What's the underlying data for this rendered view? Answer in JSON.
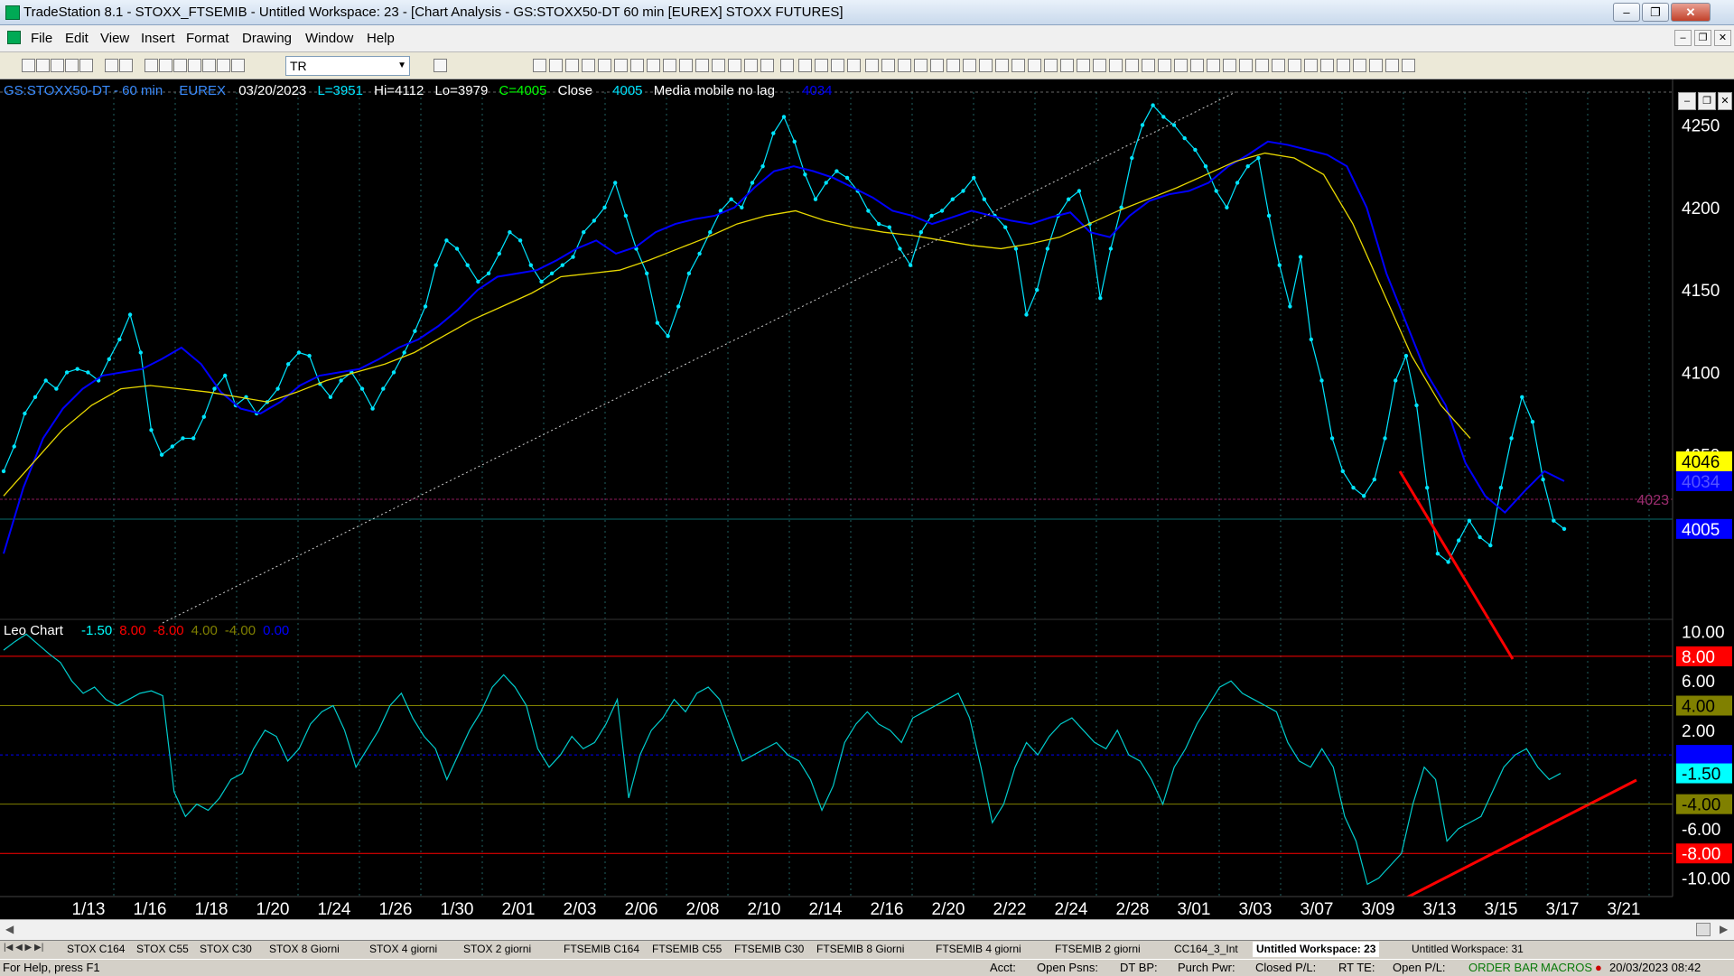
{
  "window": {
    "title": "TradeStation 8.1 - STOXX_FTSEMIB - Untitled Workspace:  23 - [Chart Analysis - GS:STOXX50-DT  60 min  [EUREX] STOXX FUTURES]",
    "minimize_label": "–",
    "restore_label": "❐",
    "close_label": "✕"
  },
  "menu": {
    "items": [
      "File",
      "Edit",
      "View",
      "Insert",
      "Format",
      "Drawing",
      "Window",
      "Help"
    ]
  },
  "toolbar": {
    "symbol": "TR"
  },
  "chart_header": {
    "symbol": "GS:STOXX50-DT - 60 min",
    "exchange": "EUREX",
    "date": "03/20/2023",
    "last": "L=3951",
    "high": "Hi=4112",
    "low": "Lo=3979",
    "close": "C=4005",
    "close_label": "Close",
    "close_value": "4005",
    "ma_label": "Media mobile no lag",
    "ma_value": "4034"
  },
  "osc_header": {
    "name": "Leo Chart",
    "values": [
      {
        "text": "-1.50",
        "color": "#00ffff"
      },
      {
        "text": "8.00",
        "color": "#ff0000"
      },
      {
        "text": "-8.00",
        "color": "#ff0000"
      },
      {
        "text": "4.00",
        "color": "#808000"
      },
      {
        "text": "-4.00",
        "color": "#808000"
      },
      {
        "text": "0.00",
        "color": "#0000ff"
      }
    ]
  },
  "chart_data": [
    {
      "type": "line",
      "price_axis_labels": [
        "4250",
        "4200",
        "4150",
        "4100",
        "4050"
      ],
      "ylim": [
        3960,
        4270
      ],
      "x_tick_labels": [
        "1/13",
        "1/16",
        "1/18",
        "1/20",
        "1/24",
        "1/26",
        "1/30",
        "2/01",
        "2/03",
        "2/06",
        "2/08",
        "2/10",
        "2/14",
        "2/16",
        "2/20",
        "2/22",
        "2/24",
        "2/28",
        "3/01",
        "3/03",
        "3/07",
        "3/09",
        "3/13",
        "3/15",
        "3/17",
        "3/21"
      ],
      "price_tags": [
        {
          "text": "4046",
          "value": 4046,
          "bg": "#ffff00",
          "fg": "#000000"
        },
        {
          "text": "4034",
          "value": 4034,
          "bg": "#0000ff",
          "fg": "#5555ff"
        },
        {
          "text": "4005",
          "value": 4005,
          "bg": "#0000ff",
          "fg": "#ffffff"
        }
      ],
      "reference_line": {
        "text": "4023",
        "value": 4023
      },
      "series": [
        {
          "name": "Close",
          "color": "#00e5ff",
          "values": [
            4040,
            4055,
            4075,
            4085,
            4095,
            4090,
            4100,
            4102,
            4100,
            4095,
            4108,
            4120,
            4135,
            4112,
            4065,
            4050,
            4055,
            4060,
            4060,
            4073,
            4090,
            4098,
            4080,
            4085,
            4075,
            4082,
            4090,
            4105,
            4112,
            4110,
            4093,
            4085,
            4095,
            4100,
            4090,
            4078,
            4090,
            4100,
            4112,
            4125,
            4140,
            4165,
            4180,
            4175,
            4165,
            4155,
            4160,
            4172,
            4185,
            4180,
            4165,
            4155,
            4160,
            4165,
            4170,
            4185,
            4192,
            4200,
            4215,
            4195,
            4175,
            4160,
            4130,
            4122,
            4140,
            4160,
            4172,
            4185,
            4198,
            4205,
            4200,
            4215,
            4225,
            4245,
            4255,
            4240,
            4220,
            4205,
            4215,
            4222,
            4218,
            4210,
            4198,
            4190,
            4188,
            4175,
            4165,
            4185,
            4195,
            4198,
            4205,
            4210,
            4218,
            4205,
            4195,
            4188,
            4175,
            4135,
            4150,
            4175,
            4195,
            4205,
            4210,
            4190,
            4145,
            4175,
            4200,
            4230,
            4250,
            4262,
            4255,
            4250,
            4242,
            4235,
            4225,
            4210,
            4200,
            4215,
            4225,
            4230,
            4195,
            4165,
            4140,
            4170,
            4120,
            4095,
            4060,
            4040,
            4030,
            4025,
            4035,
            4060,
            4095,
            4110,
            4080,
            4030,
            3990,
            3985,
            3998,
            4010,
            4000,
            3995,
            4030,
            4060,
            4085,
            4070,
            4035,
            4010,
            4005
          ]
        },
        {
          "name": "Media mobile no lag",
          "color": "#0000ff",
          "values": [
            3990,
            4030,
            4060,
            4078,
            4090,
            4098,
            4100,
            4102,
            4108,
            4115,
            4105,
            4088,
            4078,
            4075,
            4082,
            4092,
            4098,
            4100,
            4102,
            4108,
            4115,
            4120,
            4128,
            4138,
            4150,
            4158,
            4160,
            4162,
            4168,
            4175,
            4180,
            4172,
            4176,
            4185,
            4190,
            4193,
            4195,
            4200,
            4212,
            4222,
            4225,
            4222,
            4218,
            4212,
            4206,
            4198,
            4195,
            4190,
            4194,
            4198,
            4195,
            4192,
            4190,
            4194,
            4197,
            4185,
            4182,
            4195,
            4204,
            4208,
            4210,
            4215,
            4225,
            4232,
            4240,
            4238,
            4235,
            4232,
            4225,
            4200,
            4160,
            4130,
            4100,
            4080,
            4045,
            4025,
            4015,
            4028,
            4040,
            4034
          ]
        },
        {
          "name": "",
          "color": "#e8d800",
          "values": [
            4025,
            4045,
            4065,
            4080,
            4090,
            4092,
            4090,
            4088,
            4085,
            4082,
            4088,
            4095,
            4100,
            4105,
            4112,
            4122,
            4132,
            4140,
            4148,
            4158,
            4160,
            4162,
            4168,
            4175,
            4182,
            4190,
            4195,
            4198,
            4192,
            4188,
            4185,
            4183,
            4180,
            4177,
            4175,
            4178,
            4182,
            4190,
            4198,
            4205,
            4212,
            4220,
            4228,
            4233,
            4230,
            4220,
            4190,
            4150,
            4110,
            4080,
            4060
          ]
        }
      ]
    },
    {
      "type": "line",
      "name": "Leo Chart",
      "osc_axis_labels": [
        "10.00",
        "6.00",
        "2.00",
        "-6.00",
        "-10.00"
      ],
      "ylim": [
        -11.5,
        11
      ],
      "levels": [
        {
          "text": "8.00",
          "value": 8,
          "color": "#ff0000",
          "bg": "#ff0000",
          "fg": "#ffffff"
        },
        {
          "text": "4.00",
          "value": 4,
          "color": "#808000",
          "bg": "#808000",
          "fg": "#000000"
        },
        {
          "text": "0.00",
          "value": 0,
          "color": "#0000ff",
          "bg": "#0000ff",
          "fg": "#0000ff"
        },
        {
          "text": "-4.00",
          "value": -4,
          "color": "#808000",
          "bg": "#808000",
          "fg": "#000000"
        },
        {
          "text": "-8.00",
          "value": -8,
          "color": "#ff0000",
          "bg": "#ff0000",
          "fg": "#ffffff"
        }
      ],
      "current_tag": {
        "text": "-1.50",
        "value": -1.5,
        "bg": "#00ffff",
        "fg": "#000000"
      },
      "series": [
        {
          "name": "",
          "color": "#00cccc",
          "values": [
            8.5,
            9.2,
            9.8,
            9.0,
            8.2,
            7.5,
            6.0,
            5.0,
            5.5,
            4.5,
            4.0,
            4.5,
            5.0,
            5.2,
            4.8,
            -3.0,
            -5.0,
            -4.0,
            -4.5,
            -3.5,
            -2.0,
            -1.5,
            0.5,
            2.0,
            1.5,
            -0.5,
            0.5,
            2.5,
            3.5,
            4.0,
            2.0,
            -1.0,
            0.5,
            2.0,
            4.0,
            5.0,
            3.0,
            1.5,
            0.5,
            -2.0,
            0.0,
            2.0,
            3.5,
            5.5,
            6.5,
            5.5,
            4.0,
            0.5,
            -1.0,
            0.0,
            1.5,
            0.5,
            1.0,
            2.5,
            4.5,
            -3.5,
            0.0,
            2.0,
            3.0,
            4.5,
            3.5,
            5.0,
            5.5,
            4.5,
            2.0,
            -0.5,
            0.0,
            0.5,
            1.0,
            0.0,
            -0.5,
            -2.0,
            -4.5,
            -2.5,
            1.0,
            2.5,
            3.5,
            2.5,
            2.0,
            1.0,
            3.0,
            3.5,
            4.0,
            4.5,
            5.0,
            3.0,
            -1.0,
            -5.5,
            -4.0,
            -1.0,
            1.0,
            0.0,
            1.5,
            2.5,
            3.0,
            2.0,
            1.0,
            0.5,
            2.0,
            0.0,
            -0.5,
            -2.0,
            -4.0,
            -1.0,
            0.5,
            2.5,
            4.0,
            5.5,
            6.0,
            5.0,
            4.5,
            4.0,
            3.5,
            1.0,
            -0.5,
            -1.0,
            0.5,
            -1.0,
            -5.0,
            -7.0,
            -10.5,
            -10.0,
            -9.0,
            -8.0,
            -4.0,
            -1.0,
            -2.0,
            -7.0,
            -6.0,
            -5.5,
            -5.0,
            -3.0,
            -1.0,
            0.0,
            0.5,
            -1.0,
            -2.0,
            -1.5
          ]
        }
      ]
    }
  ],
  "tabs": [
    "STOX C164",
    "STOX C55",
    "STOX  C30",
    "STOX  8 Giorni",
    "STOX 4 giorni",
    "STOX  2 giorni",
    "FTSEMIB C164",
    "FTSEMIB C55",
    "FTSEMIB C30",
    "FTSEMIB  8 Giorni",
    "FTSEMIB  4 giorni",
    "FTSEMIB  2 giorni",
    "CC164_3_Int",
    "Untitled Workspace:  23",
    "Untitled Workspace:  31"
  ],
  "active_tab": 13,
  "status": {
    "help": "For Help, press F1",
    "acct": "Acct:",
    "open_psns": "Open Psns:",
    "dt_bp": "DT BP:",
    "purch_pwr": "Purch Pwr:",
    "closed_pl": "Closed P/L:",
    "rt_te": "RT TE:",
    "open_pl": "Open P/L:",
    "order_bar": "ORDER BAR",
    "macros": "MACROS",
    "datetime": "20/03/2023 08:42"
  }
}
